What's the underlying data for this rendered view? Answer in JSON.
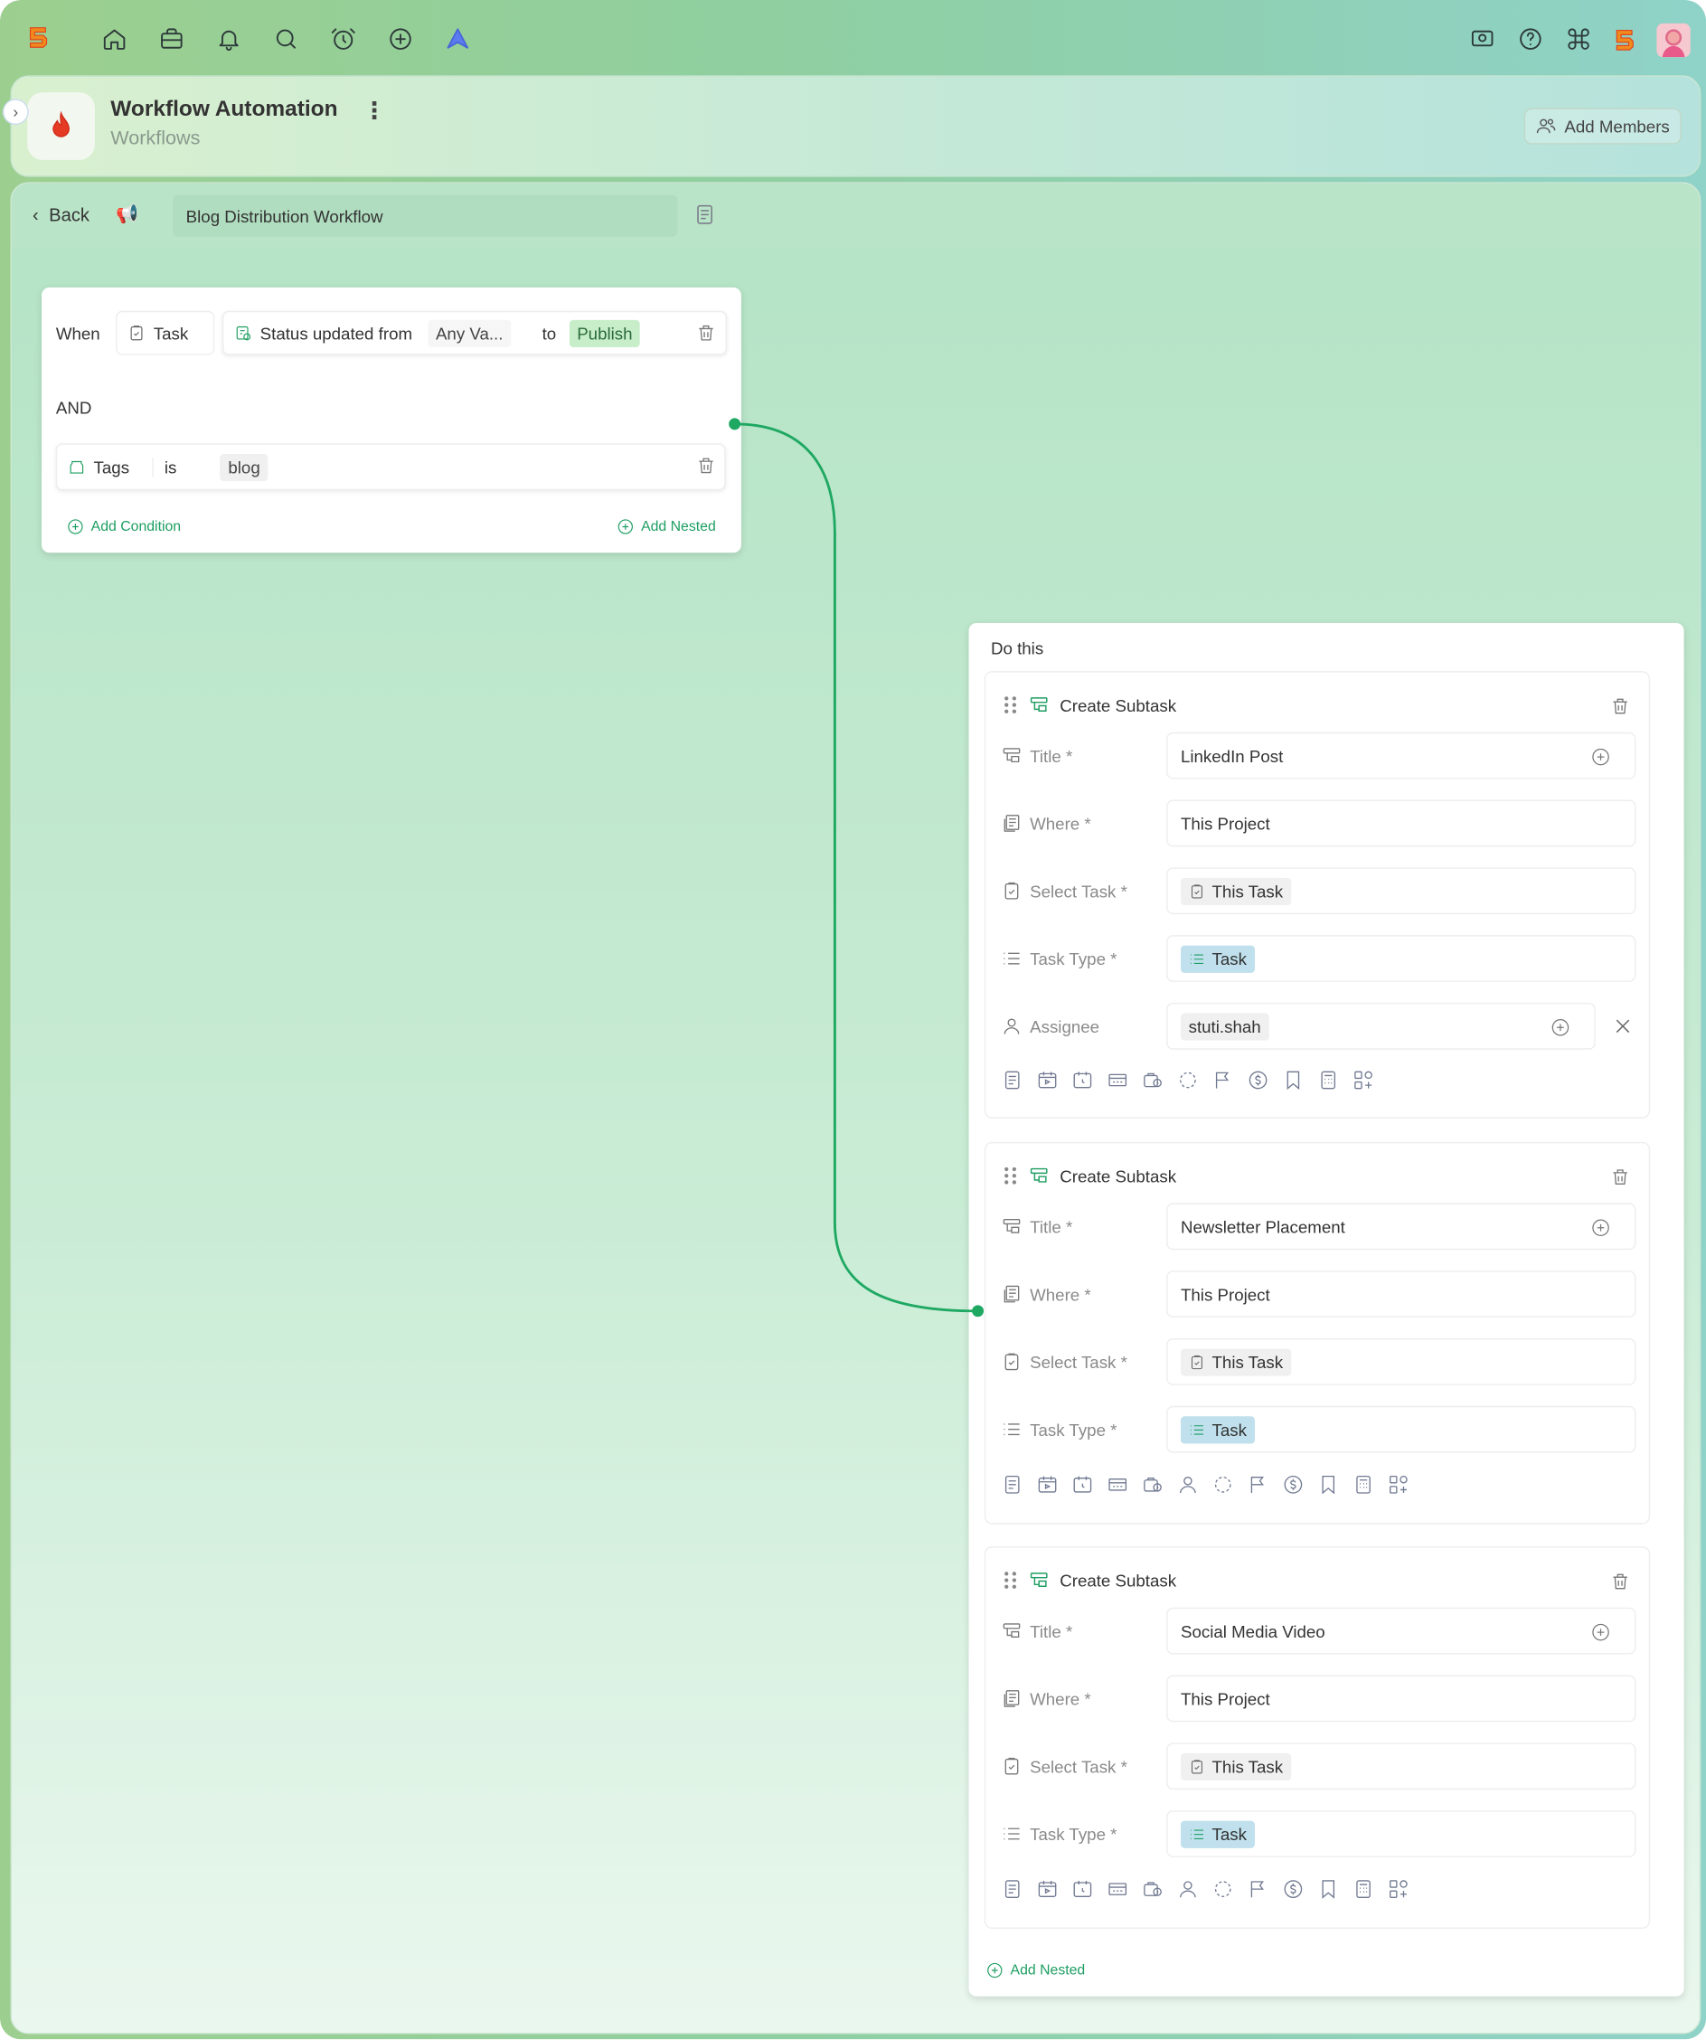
{
  "app": {
    "title": "Workflow Automation",
    "subtitle": "Workflows",
    "add_members_label": "Add Members"
  },
  "breadcrumb": {
    "back_label": "Back",
    "workflow_name": "Blog Distribution Workflow"
  },
  "trigger": {
    "when_label": "When",
    "entity": "Task",
    "condition_label": "Status updated from",
    "from_value": "Any Va...",
    "to_label": "to",
    "to_value": "Publish",
    "and_label": "AND",
    "tag_field": "Tags",
    "tag_op": "is",
    "tag_value": "blog",
    "add_condition_label": "Add Condition",
    "add_nested_label": "Add Nested"
  },
  "actions": {
    "title": "Do this",
    "add_nested_label": "Add Nested",
    "items": [
      {
        "name": "Create Subtask",
        "title_label": "Title *",
        "title_value": "LinkedIn Post",
        "where_label": "Where *",
        "where_value": "This Project",
        "select_label": "Select Task *",
        "select_value": "This Task",
        "type_label": "Task Type *",
        "type_value": "Task",
        "assignee_label": "Assignee",
        "assignee_value": "stuti.shah"
      },
      {
        "name": "Create Subtask",
        "title_label": "Title *",
        "title_value": "Newsletter Placement",
        "where_label": "Where *",
        "where_value": "This Project",
        "select_label": "Select Task *",
        "select_value": "This Task",
        "type_label": "Task Type *",
        "type_value": "Task"
      },
      {
        "name": "Create Subtask",
        "title_label": "Title *",
        "title_value": "Social Media Video",
        "where_label": "Where *",
        "where_value": "This Project",
        "select_label": "Select Task *",
        "select_value": "This Task",
        "type_label": "Task Type *",
        "type_value": "Task"
      }
    ]
  },
  "colors": {
    "accent": "#1e9e62",
    "publish_bg": "#c7eec9",
    "task_type_bg": "#bfe0ec"
  }
}
